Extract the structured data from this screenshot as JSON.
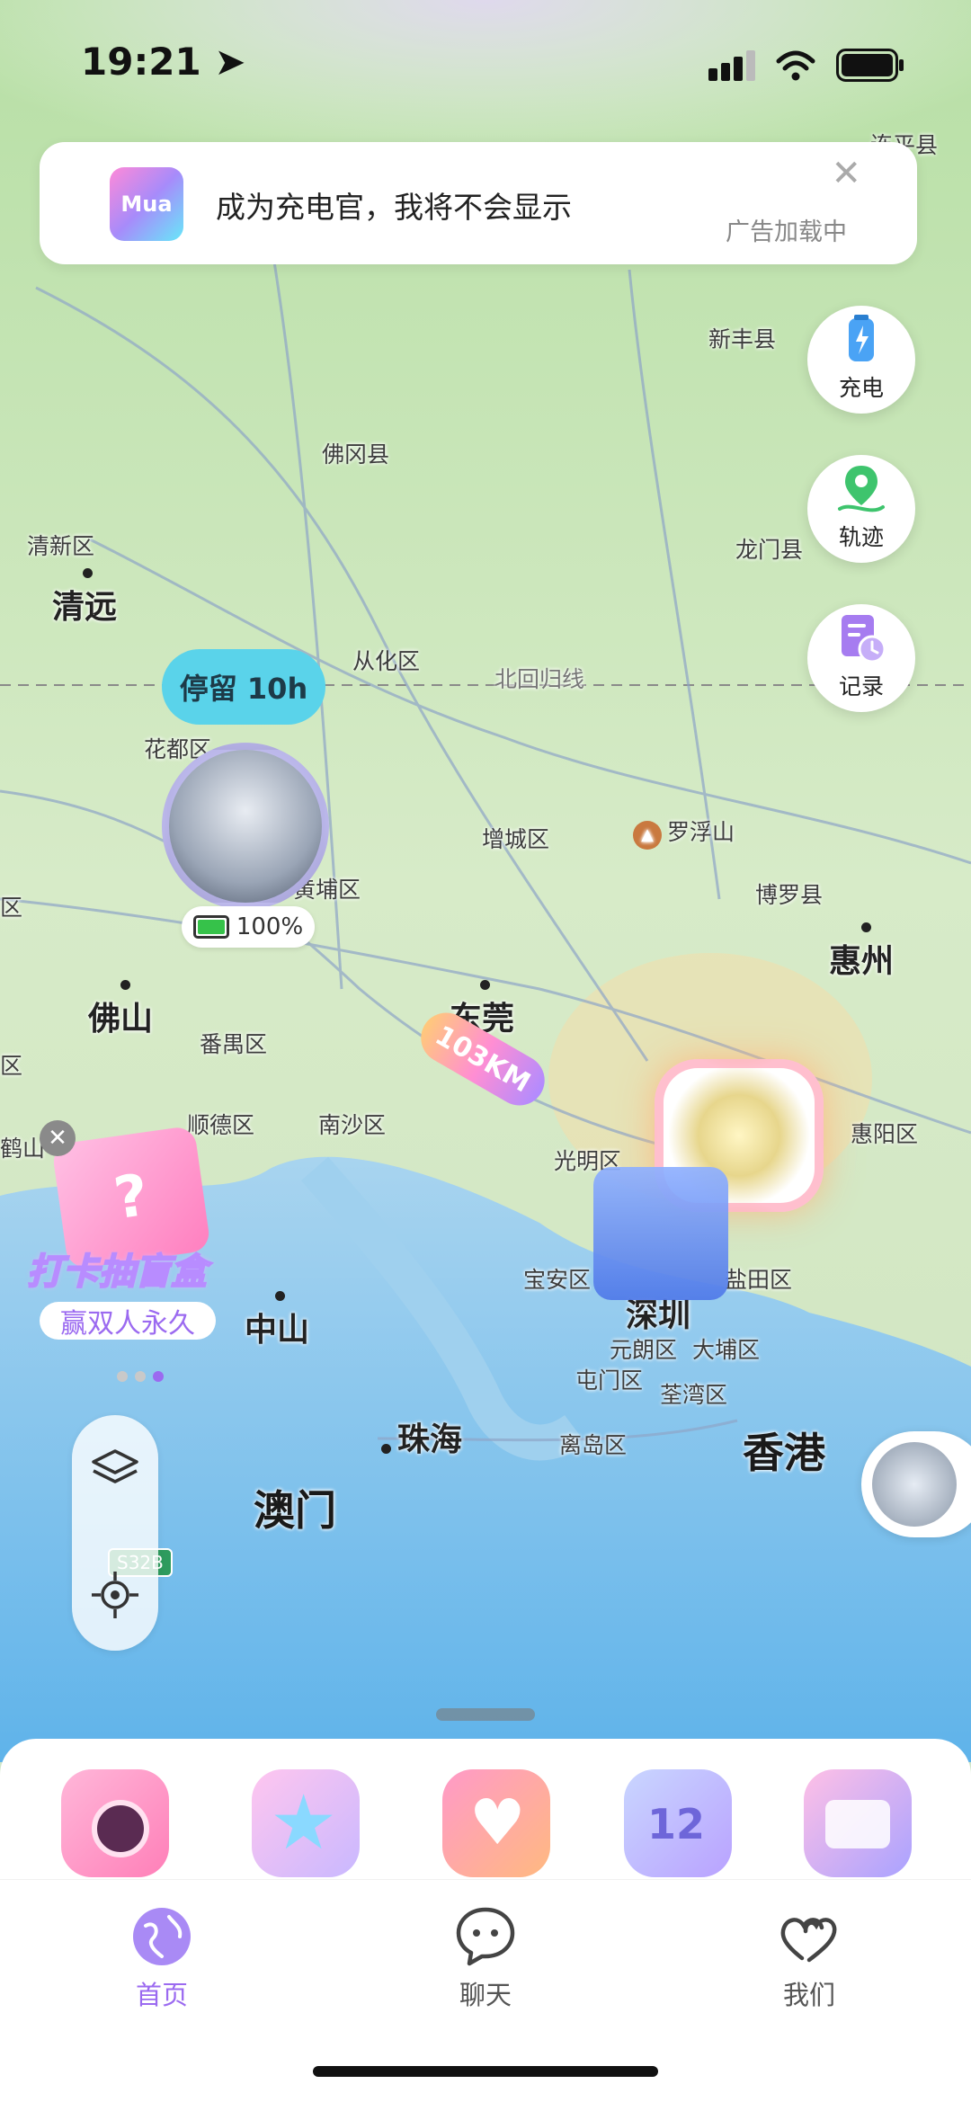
{
  "status": {
    "time": "19:21"
  },
  "ad": {
    "logo": "Mua",
    "title": "成为充电官，我将不会显示",
    "subtitle": "广告加载中",
    "close": "✕"
  },
  "side_buttons": [
    {
      "label": "充电",
      "icon": "battery-charge-icon"
    },
    {
      "label": "轨迹",
      "icon": "location-track-icon"
    },
    {
      "label": "记录",
      "icon": "record-clock-icon"
    }
  ],
  "map_labels": {
    "top_right": "连平县",
    "xinfeng": "新丰县",
    "fogang": "佛冈县",
    "qingxin": "清新区",
    "qingyuan": "清远",
    "longmen": "龙门县",
    "conghua": "从化区",
    "tropic": "北回归线",
    "huadu": "花都区",
    "zengcheng": "增城区",
    "luofushan": "罗浮山",
    "huangpu": "黄埔区",
    "boluo": "博罗县",
    "huizhou": "惠州",
    "left_edge": "区",
    "foshan": "佛山",
    "dongguan": "东莞",
    "panyu": "番禺区",
    "left_edge2": "区",
    "shunde": "顺德区",
    "nansha": "南沙区",
    "guangming": "光明区",
    "huiyang": "惠阳区",
    "heshan": "鹤山",
    "baoan": "宝安区",
    "shenzhen": "深圳",
    "yantian": "盐田区",
    "yuanlang": "元朗区",
    "dapu": "大埔区",
    "tuenmun": "屯门区",
    "tsuenwan": "荃湾区",
    "zhongshan": "中山",
    "zhuhai": "珠海",
    "lidao": "离岛区",
    "hongkong": "香港",
    "macau": "澳门",
    "road": "S32B"
  },
  "stay_bubble": "停留 10h",
  "battery": "100%",
  "distance": "103KM",
  "blind_box": {
    "title": "打卡抽盲盒",
    "subtitle": "赢双人永久"
  },
  "tabs": [
    {
      "label": "首页",
      "icon": "globe-icon",
      "active": true
    },
    {
      "label": "聊天",
      "icon": "chat-icon",
      "active": false
    },
    {
      "label": "我们",
      "icon": "hearts-icon",
      "active": false
    }
  ],
  "colors": {
    "accent": "#9b6af0",
    "bubble": "#5ad3ea"
  }
}
